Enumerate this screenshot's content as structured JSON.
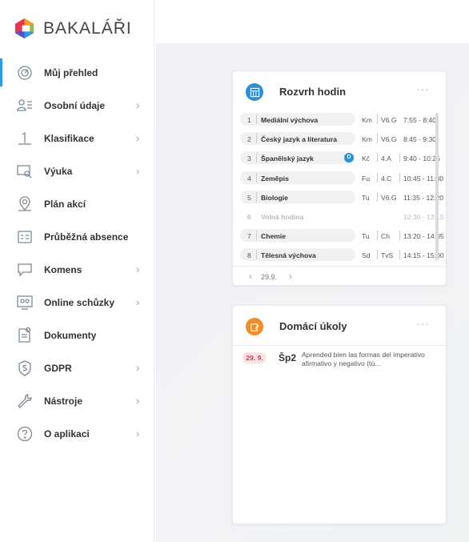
{
  "app": {
    "brand": "BAKALÁŘI"
  },
  "sidebar": {
    "items": [
      {
        "label": "Můj přehled",
        "icon": "dashboard-icon",
        "chevron": false,
        "active": true
      },
      {
        "label": "Osobní údaje",
        "icon": "personal-data-icon",
        "chevron": true
      },
      {
        "label": "Klasifikace",
        "icon": "grades-icon",
        "chevron": true
      },
      {
        "label": "Výuka",
        "icon": "teaching-icon",
        "chevron": true
      },
      {
        "label": "Plán akcí",
        "icon": "events-icon",
        "chevron": false
      },
      {
        "label": "Průběžná absence",
        "icon": "absence-icon",
        "chevron": false
      },
      {
        "label": "Komens",
        "icon": "messages-icon",
        "chevron": true
      },
      {
        "label": "Online schůzky",
        "icon": "online-meetings-icon",
        "chevron": true
      },
      {
        "label": "Dokumenty",
        "icon": "documents-icon",
        "chevron": false
      },
      {
        "label": "GDPR",
        "icon": "gdpr-icon",
        "chevron": true
      },
      {
        "label": "Nástroje",
        "icon": "tools-icon",
        "chevron": true
      },
      {
        "label": "O aplikaci",
        "icon": "about-icon",
        "chevron": true
      }
    ],
    "chevron_glyph": "›"
  },
  "schedule": {
    "title": "Rozvrh hodin",
    "more": "···",
    "rows": [
      {
        "num": "1",
        "subject": "Mediální výchova",
        "teacher": "Km",
        "room": "V6.G",
        "time": "7:55 - 8:40"
      },
      {
        "num": "2",
        "subject": "Český jazyk a literatura",
        "teacher": "Km",
        "room": "V6.G",
        "time": "8:45 - 9:30"
      },
      {
        "num": "3",
        "subject": "Španělský jazyk",
        "badge": "D",
        "teacher": "Kč",
        "room": "4.A",
        "time": "9:40 - 10:25"
      },
      {
        "num": "4",
        "subject": "Zeměpis",
        "teacher": "Fu",
        "room": "4.C",
        "time": "10:45 - 11:30"
      },
      {
        "num": "5",
        "subject": "Biologie",
        "teacher": "Tu",
        "room": "V6.G",
        "time": "11:35 - 12:20"
      },
      {
        "num": "6",
        "subject": "Volná hodina",
        "teacher": "",
        "room": "",
        "time": "12:30 - 13:15",
        "free": true
      },
      {
        "num": "7",
        "subject": "Chemie",
        "teacher": "Tu",
        "room": "Ch",
        "time": "13:20 - 14:05"
      },
      {
        "num": "8",
        "subject": "Tělesná výchova",
        "teacher": "Sd",
        "room": "TvS",
        "time": "14:15 - 15:00"
      }
    ],
    "date": "29.9.",
    "prev": "‹",
    "next": "›"
  },
  "homework": {
    "title": "Domácí úkoly",
    "more": "···",
    "items": [
      {
        "date": "29. 9.",
        "subject": "Šp2",
        "text": "Aprended bien las formas del imperativo afirmativo y negativo (tú..."
      }
    ]
  },
  "colors": {
    "accent": "#2a9de0",
    "schedule_icon": "#2b8fd6",
    "homework_icon": "#f28c28",
    "date_badge": "#d23a4f"
  }
}
